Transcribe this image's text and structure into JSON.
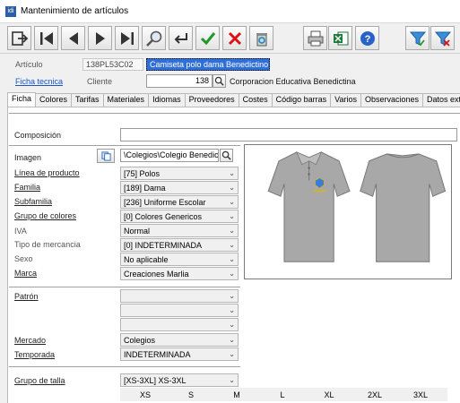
{
  "window": {
    "title": "Mantenimiento de artículos",
    "app_icon": "idi"
  },
  "toolbar": {
    "buttons": [
      "exit-icon",
      "first-icon",
      "prev-icon",
      "next-icon",
      "last-icon",
      "search-icon",
      "undo-icon",
      "accept-icon",
      "cancel-icon",
      "recycle-delete-icon",
      "print-icon",
      "excel-icon",
      "help-icon",
      "filter-icon",
      "clear-filter-icon"
    ]
  },
  "header": {
    "articulo_label": "Artículo",
    "articulo_code": "138PL53C02",
    "articulo_name": "Camiseta polo dama Benedictino",
    "ficha_tecnica_link": "Ficha tecnica",
    "cliente_label": "Cliente",
    "cliente_code": "138",
    "cliente_name": "Corporacion Educativa Benedictina"
  },
  "tabs": [
    "Ficha",
    "Colores",
    "Tarifas",
    "Materiales",
    "Idiomas",
    "Proveedores",
    "Costes",
    "Código barras",
    "Varios",
    "Observaciones",
    "Datos extra"
  ],
  "active_tab": "Ficha",
  "form": {
    "composicion_label": "Composición",
    "composicion_value": "",
    "imagen_label": "Imagen",
    "imagen_path": "\\Colegios\\Colegio Benedict",
    "fields": [
      {
        "label": "Línea de producto",
        "link": true,
        "value": "[75] Polos"
      },
      {
        "label": "Familia",
        "link": true,
        "value": "[189] Dama"
      },
      {
        "label": "Subfamilia",
        "link": true,
        "value": "[236] Uniforme Escolar"
      },
      {
        "label": "Grupo de colores",
        "link": true,
        "value": "[0] Colores Genericos"
      },
      {
        "label": "IVA",
        "link": false,
        "value": "Normal"
      },
      {
        "label": "Tipo de mercancia",
        "link": false,
        "value": "[0] INDETERMINADA"
      },
      {
        "label": "Sexo",
        "link": false,
        "value": "No aplicable"
      },
      {
        "label": "Marca",
        "link": true,
        "value": "Creaciones Marlia"
      }
    ],
    "patron_label": "Patrón",
    "patron_values": [
      "",
      "",
      ""
    ],
    "mercado_label": "Mercado",
    "mercado_value": "Colegios",
    "temporada_label": "Temporada",
    "temporada_value": "INDETERMINADA",
    "grupo_talla_label": "Grupo de talla",
    "grupo_talla_value": "[XS-3XL] XS-3XL",
    "sizes": [
      "XS",
      "S",
      "M",
      "L",
      "XL",
      "2XL",
      "3XL"
    ]
  },
  "colors": {
    "accent": "#1a55c8",
    "selection": "#2f6fd6",
    "shirt": "#a8a8a8"
  }
}
